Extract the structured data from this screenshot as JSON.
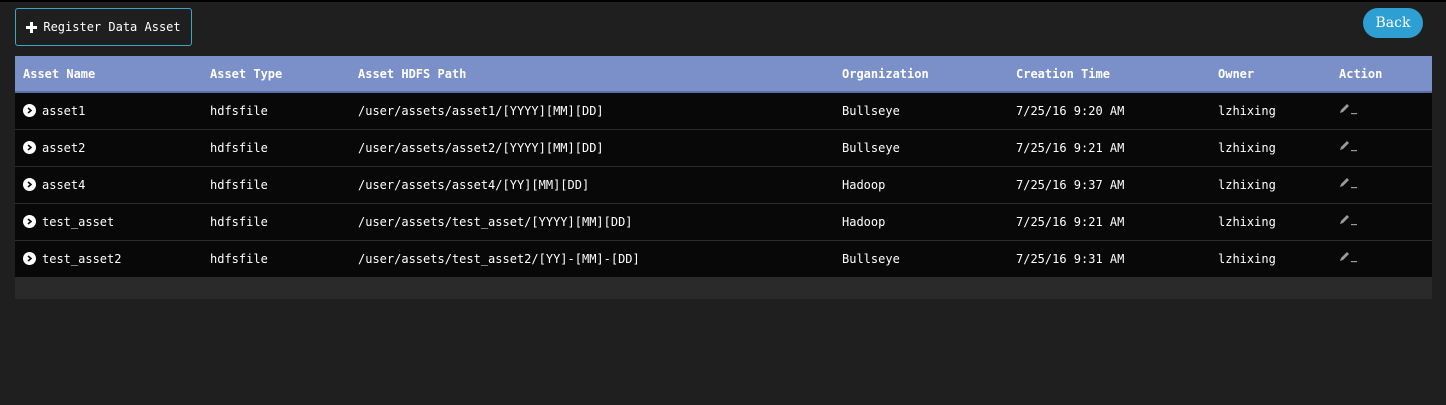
{
  "toolbar": {
    "register_label": "Register Data Asset",
    "register_icon": "plus-icon",
    "back_label": "Back"
  },
  "colors": {
    "accent": "#2e9fd3",
    "header_bg": "#7b8fc8",
    "row_bg": "#080808",
    "page_bg": "#1f1f1f"
  },
  "table": {
    "columns": [
      "Asset Name",
      "Asset Type",
      "Asset HDFS Path",
      "Organization",
      "Creation Time",
      "Owner",
      "Action"
    ],
    "rows": [
      {
        "name": "asset1",
        "type": "hdfsfile",
        "path": "/user/assets/asset1/[YYYY][MM][DD]",
        "organization": "Bullseye",
        "creation_time": "7/25/16 9:20 AM",
        "owner": "lzhixing",
        "action_icon": "edit-icon"
      },
      {
        "name": "asset2",
        "type": "hdfsfile",
        "path": "/user/assets/asset2/[YYYY][MM][DD]",
        "organization": "Bullseye",
        "creation_time": "7/25/16 9:21 AM",
        "owner": "lzhixing",
        "action_icon": "edit-icon"
      },
      {
        "name": "asset4",
        "type": "hdfsfile",
        "path": "/user/assets/asset4/[YY][MM][DD]",
        "organization": "Hadoop",
        "creation_time": "7/25/16 9:37 AM",
        "owner": "lzhixing",
        "action_icon": "edit-icon"
      },
      {
        "name": "test_asset",
        "type": "hdfsfile",
        "path": "/user/assets/test_asset/[YYYY][MM][DD]",
        "organization": "Hadoop",
        "creation_time": "7/25/16 9:21 AM",
        "owner": "lzhixing",
        "action_icon": "edit-icon"
      },
      {
        "name": "test_asset2",
        "type": "hdfsfile",
        "path": "/user/assets/test_asset2/[YY]-[MM]-[DD]",
        "organization": "Bullseye",
        "creation_time": "7/25/16 9:31 AM",
        "owner": "lzhixing",
        "action_icon": "edit-icon"
      }
    ]
  }
}
